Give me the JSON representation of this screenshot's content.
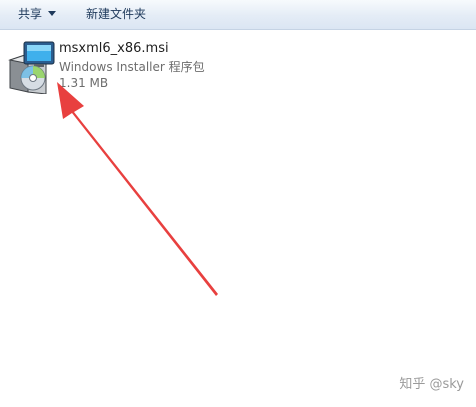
{
  "toolbar": {
    "share_label": "共享",
    "new_folder_label": "新建文件夹"
  },
  "file": {
    "name": "msxml6_x86.msi",
    "type": "Windows Installer 程序包",
    "size": "1.31 MB",
    "icon": "msi-installer-icon"
  },
  "annotation": {
    "arrow_color": "#e8403f",
    "watermark": "知乎 @sky"
  }
}
